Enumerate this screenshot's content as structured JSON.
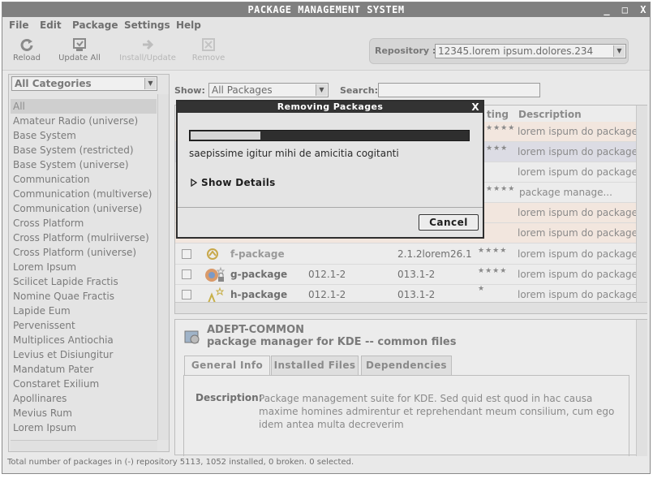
{
  "window": {
    "title": "PACKAGE MANAGEMENT SYSTEM",
    "controls": [
      "_",
      "□",
      "X"
    ]
  },
  "menu": [
    "File",
    "Edit",
    "Package",
    "Settings",
    "Help"
  ],
  "toolbar": {
    "reload": "Reload",
    "update_all": "Update All",
    "install_update": "Install/Update",
    "remove": "Remove"
  },
  "repository": {
    "label": "Repository :",
    "value": "12345.lorem ipsum.dolores.234"
  },
  "categories": {
    "selected": "All Categories",
    "items": [
      "All",
      "Amateur Radio (universe)",
      "Base System",
      "Base System (restricted)",
      "Base System (universe)",
      "Communication",
      "Communication (multiverse)",
      "Communication (universe)",
      "Cross Platform",
      "Cross Platform (mulriiverse)",
      "Cross Platform (universe)",
      "Lorem Ipsum",
      "Scilicet Lapide Fractis",
      "Nomine Quae Fractis",
      "Lapide Eum",
      "Pervenissent",
      "Multiplices Antiochia",
      "Levius et Disiungitur",
      "Mandatum Pater",
      "Constaret Exilium",
      "Apollinares",
      "Mevius Rum",
      "Lorem Ipsum"
    ]
  },
  "filter": {
    "show_label": "Show:",
    "show_value": "All Packages",
    "search_label": "Search:",
    "search_value": ""
  },
  "table": {
    "headers": {
      "rating": "ting",
      "description": "Description"
    },
    "partial_rows": [
      {
        "stars": "★★★★",
        "description": "lorem ispum do package..."
      },
      {
        "stars": "★★★",
        "description": "lorem ispum do package..."
      },
      {
        "stars": "",
        "description": "lorem ispum do package..."
      },
      {
        "stars": "★★★★",
        "description": "package manage..."
      },
      {
        "stars": "",
        "description": "lorem ispum do package..."
      },
      {
        "stars": "",
        "description": "lorem ispum do package..."
      }
    ],
    "rows": [
      {
        "name": "f-package",
        "installed": "",
        "available": "2.1.2lorem26.1",
        "stars": "★★★★",
        "description": "lorem ispum do package..."
      },
      {
        "name": "g-package",
        "installed": "012.1-2",
        "available": "013.1-2",
        "stars": "★★★★",
        "description": "lorem ispum do package..."
      },
      {
        "name": "h-package",
        "installed": "012.1-2",
        "available": "013.1-2",
        "stars": "★",
        "description": "lorem ispum do package..."
      }
    ]
  },
  "detail": {
    "package_name": "ADEPT-COMMON",
    "package_summary": "package manager for KDE -- common files",
    "tabs": [
      "General Info",
      "Installed Files",
      "Dependencies"
    ],
    "description_label": "Description:",
    "description_text": "Package management suite for KDE. Sed quid est quod in hac causa maxime homines admirentur et reprehendant meum consilium, cum ego idem antea multa decreverim"
  },
  "status": "Total number of packages in (-) repository 5113, 1052 installed, 0 broken. 0 selected.",
  "dialog": {
    "title": "Removing Packages",
    "close": "X",
    "progress": 0.25,
    "message": "saepissime igitur mihi de amicitia cogitanti",
    "details_toggle": "Show Details",
    "cancel": "Cancel"
  }
}
